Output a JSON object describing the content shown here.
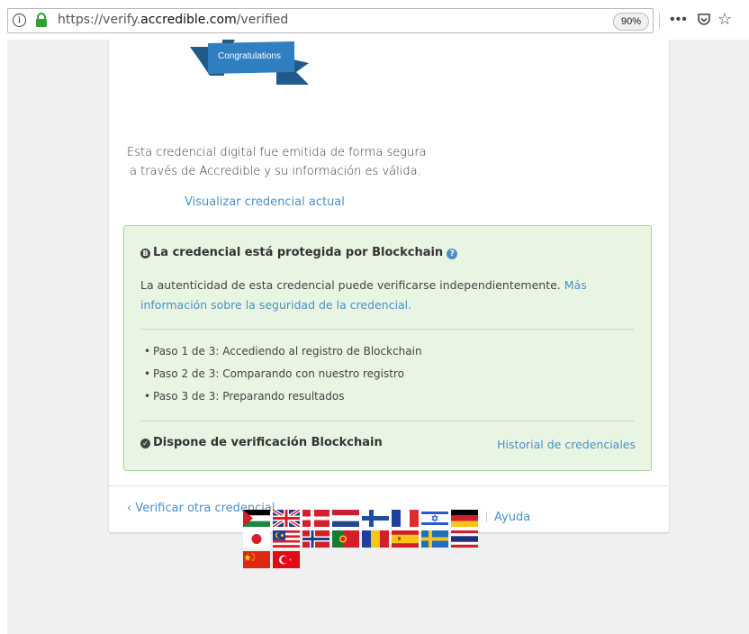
{
  "browser": {
    "url_prefix": "https://verify.",
    "url_domain": "accredible.com",
    "url_path": "/verified",
    "zoom": "90%",
    "info_glyph": "i",
    "more_glyph": "•••",
    "star_glyph": "☆",
    "icons": [
      "info-icon",
      "lock-icon",
      "more-icon",
      "pocket-icon",
      "star-icon"
    ]
  },
  "certificate": {
    "ribbon_label": "Congratulations",
    "issued_line1": "Esta credencial digital fue emitida de forma segura",
    "issued_line2": "a través de Accredible y su información es válida.",
    "view_link": "Visualizar credencial actual"
  },
  "blockchain": {
    "title": "La credencial está protegida por Blockchain",
    "help_glyph": "?",
    "description": "La autenticidad de esta credencial puede verificarse independientemente.",
    "more_info_link": "Más información sobre la seguridad de la credencial.",
    "steps": [
      "Paso 1 de 3: Accediendo al registro de Blockchain",
      "Paso 2 de 3: Comparando con nuestro registro",
      "Paso 3 de 3: Preparando resultados"
    ],
    "verified_label": "Dispone de verificación Blockchain",
    "check_glyph": "✓",
    "history_link": "Historial de credenciales"
  },
  "footer": {
    "verify_other_link": "Verificar otra credencial",
    "help_link": "Ayuda"
  },
  "colors": {
    "link": "#4a90c8",
    "green_bg": "#e8f5e3",
    "green_border": "#a8d39a",
    "ribbon": "#2f7fc1",
    "ribbon_dark": "#1f5a8a"
  },
  "languages": [
    "arabic",
    "english-uk",
    "danish",
    "dutch",
    "finnish",
    "french",
    "hebrew",
    "german",
    "japanese",
    "malay",
    "norwegian",
    "portuguese",
    "romanian",
    "spanish",
    "swedish",
    "thai",
    "chinese",
    "turkish"
  ]
}
